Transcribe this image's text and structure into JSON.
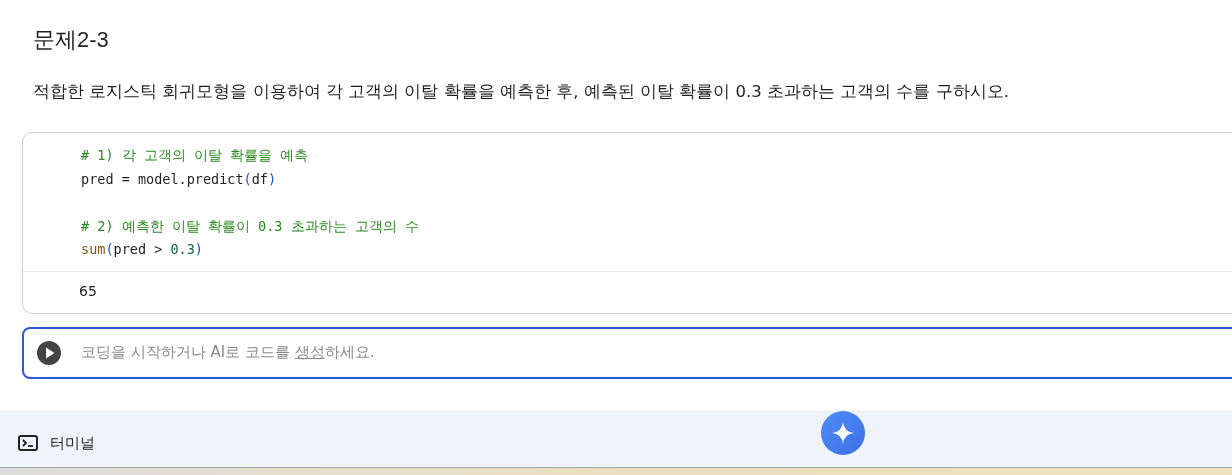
{
  "heading": "문제2-3",
  "description": "적합한 로지스틱 회귀모형을 이용하여 각 고객의 이탈 확률을 예측한 후, 예측된 이탈 확률이 0.3 초과하는 고객의 수를 구하시오.",
  "code_cell": {
    "lines": [
      {
        "kind": "code",
        "tokens": [
          {
            "kind": "comment",
            "text": "# 1) 각 고객의 이탈 확률을 예측"
          }
        ]
      },
      {
        "kind": "code",
        "tokens": [
          {
            "kind": "plain",
            "text": "pred = model.predict"
          },
          {
            "kind": "paren",
            "text": "("
          },
          {
            "kind": "plain",
            "text": "df"
          },
          {
            "kind": "paren",
            "text": ")"
          }
        ]
      },
      {
        "kind": "blank"
      },
      {
        "kind": "code",
        "tokens": [
          {
            "kind": "comment",
            "text": "# 2) 예측한 이탈 확률이 0.3 초과하는 고객의 수"
          }
        ]
      },
      {
        "kind": "code",
        "tokens": [
          {
            "kind": "builtin",
            "text": "sum"
          },
          {
            "kind": "paren",
            "text": "("
          },
          {
            "kind": "plain",
            "text": "pred > "
          },
          {
            "kind": "number",
            "text": "0.3"
          },
          {
            "kind": "paren",
            "text": ")"
          }
        ]
      }
    ],
    "output": "65"
  },
  "new_cell": {
    "placeholder_before": "코딩을 시작하거나 AI로 코드를 ",
    "placeholder_link": "생성",
    "placeholder_after": "하세요."
  },
  "status_bar": {
    "terminal_label": "터미널"
  }
}
